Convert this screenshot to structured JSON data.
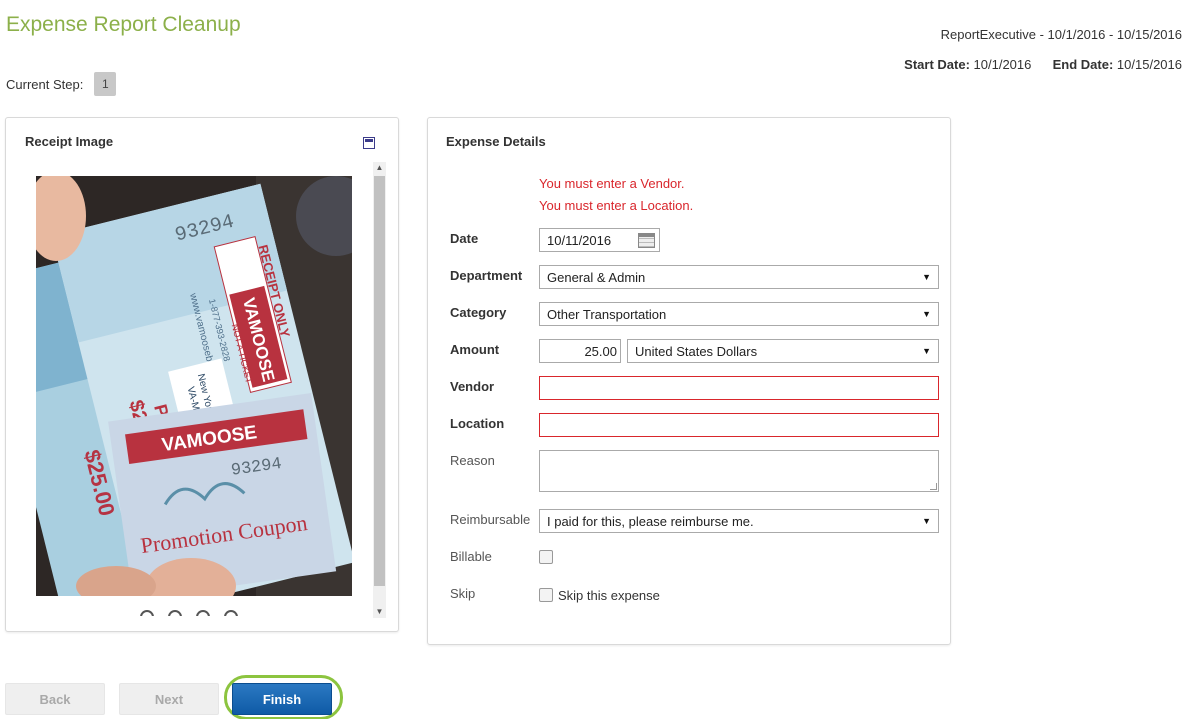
{
  "header": {
    "title": "Expense Report Cleanup",
    "report_info": "ReportExecutive - 10/1/2016 - 10/15/2016",
    "start_label": "Start Date:",
    "start_value": "10/1/2016",
    "end_label": "End Date:",
    "end_value": "10/15/2016",
    "step_label": "Current Step:",
    "step_value": "1"
  },
  "receipt": {
    "title": "Receipt Image",
    "image_text": {
      "ticket_number": "93294",
      "brand": "VAMOOSE",
      "receipt_only": "RECEIPT ONLY",
      "not_a_ticket": "NOT A TICKET",
      "website": "www.vamoosebus.com",
      "phone": "1-877-393-2828",
      "route_top": "New York City",
      "route_bottom": "VA-MD-DC",
      "paid": "PAID",
      "amount": "$25.00",
      "coupon": "Promotion Coupon"
    }
  },
  "details": {
    "title": "Expense Details",
    "errors": [
      "You must enter a Vendor.",
      "You must enter a Location."
    ],
    "labels": {
      "date": "Date",
      "department": "Department",
      "category": "Category",
      "amount": "Amount",
      "vendor": "Vendor",
      "location": "Location",
      "reason": "Reason",
      "reimbursable": "Reimbursable",
      "billable": "Billable",
      "skip": "Skip"
    },
    "values": {
      "date": "10/11/2016",
      "department": "General & Admin",
      "category": "Other Transportation",
      "amount": "25.00",
      "currency": "United States Dollars",
      "vendor": "",
      "location": "",
      "reason": "",
      "reimbursable": "I paid for this, please reimburse me.",
      "skip_text": "Skip this expense"
    }
  },
  "buttons": {
    "back": "Back",
    "next": "Next",
    "finish": "Finish"
  },
  "colors": {
    "title_green": "#8cb04a",
    "error_red": "#d9262c",
    "primary_blue": "#1666b2",
    "highlight_green": "#8cc43f"
  }
}
